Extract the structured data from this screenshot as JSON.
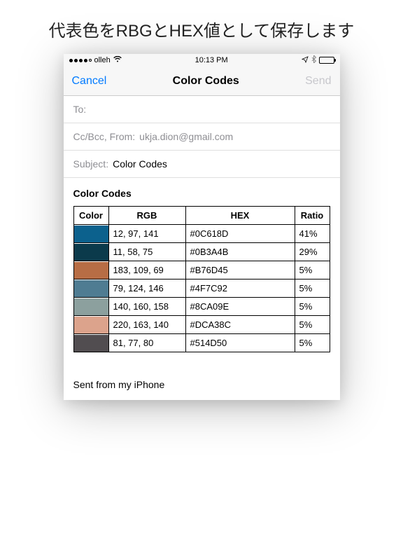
{
  "caption": "代表色をRBGとHEX値として保存します",
  "status": {
    "carrier": "olleh",
    "time": "10:13 PM"
  },
  "nav": {
    "cancel": "Cancel",
    "title": "Color Codes",
    "send": "Send"
  },
  "compose": {
    "to_label": "To:",
    "ccbcc_label": "Cc/Bcc, From:",
    "from_value": "ukja.dion@gmail.com",
    "subject_label": "Subject:",
    "subject_value": "Color Codes"
  },
  "body": {
    "heading": "Color Codes",
    "headers": {
      "c1": "Color",
      "c2": "RGB",
      "c3": "HEX",
      "c4": "Ratio"
    },
    "rows": [
      {
        "hex": "#0C618D",
        "rgb": "12, 97, 141",
        "ratio": "41%"
      },
      {
        "hex": "#0B3A4B",
        "rgb": "11, 58, 75",
        "ratio": "29%"
      },
      {
        "hex": "#B76D45",
        "rgb": "183, 109, 69",
        "ratio": "5%"
      },
      {
        "hex": "#4F7C92",
        "rgb": "79, 124, 146",
        "ratio": "5%"
      },
      {
        "hex": "#8CA09E",
        "rgb": "140, 160, 158",
        "ratio": "5%"
      },
      {
        "hex": "#DCA38C",
        "rgb": "220, 163, 140",
        "ratio": "5%"
      },
      {
        "hex": "#514D50",
        "rgb": "81, 77, 80",
        "ratio": "5%"
      }
    ],
    "signature": "Sent from my iPhone"
  }
}
